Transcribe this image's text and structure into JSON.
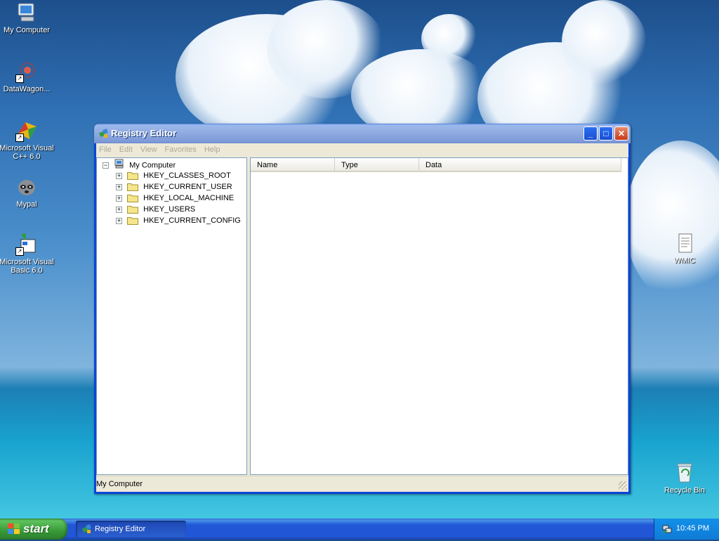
{
  "desktop": {
    "icons": [
      {
        "label": "My Computer"
      },
      {
        "label": "DataWagon..."
      },
      {
        "label": "Microsoft Visual C++ 6.0"
      },
      {
        "label": "Mypal"
      },
      {
        "label": "Microsoft Visual Basic 6.0"
      },
      {
        "label": "WMIC"
      },
      {
        "label": "Recycle Bin"
      }
    ]
  },
  "window": {
    "title": "Registry Editor",
    "menu": [
      "File",
      "Edit",
      "View",
      "Favorites",
      "Help"
    ],
    "tree": {
      "root": "My Computer",
      "expander_collapsed": "+",
      "expander_expanded": "−",
      "children": [
        "HKEY_CLASSES_ROOT",
        "HKEY_CURRENT_USER",
        "HKEY_LOCAL_MACHINE",
        "HKEY_USERS",
        "HKEY_CURRENT_CONFIG"
      ]
    },
    "columns": [
      "Name",
      "Type",
      "Data"
    ],
    "status": "My Computer"
  },
  "taskbar": {
    "start_label": "start",
    "task_label": "Registry Editor",
    "clock": "10:45 PM"
  },
  "colors": {
    "titlebar_accent": "#0a46d8",
    "taskbar": "#2157d7",
    "start_green": "#379937"
  }
}
